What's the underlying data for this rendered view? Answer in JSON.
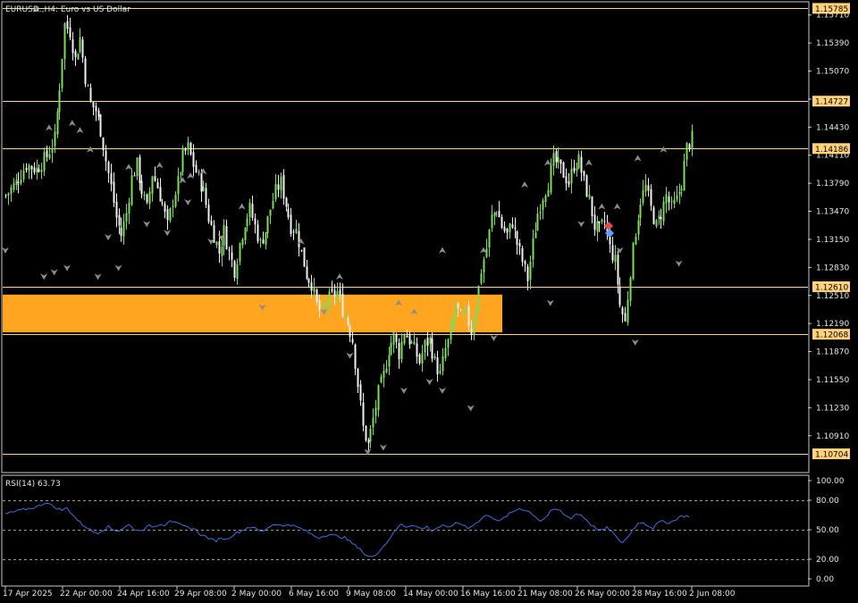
{
  "header": {
    "symbol_title": "EURUSD.,H4:  Euro vs US Dollar",
    "rsi_title": "RSI(14) 63.73"
  },
  "colors": {
    "background": "#000000",
    "bull_candle": "#7fdc5a",
    "bear_candle": "#f0f0f0",
    "level_line": "#ffd27a",
    "level_badge": "#ffd27a",
    "zone_fill": "#ffa51f",
    "rsi_line": "#3d6ee8",
    "frame": "#c8c8c8",
    "fractal": "#8c8c8c"
  },
  "price_axis": {
    "range": [
      1.105,
      1.1585
    ],
    "ticks": [
      "1.15710",
      "1.15390",
      "1.15070",
      "1.14750",
      "1.14430",
      "1.14110",
      "1.13790",
      "1.13470",
      "1.13150",
      "1.12830",
      "1.12510",
      "1.12190",
      "1.11870",
      "1.11550",
      "1.11230",
      "1.10910"
    ]
  },
  "level_badges": [
    {
      "label": "1.15785",
      "value": 1.15785
    },
    {
      "label": "1.14727",
      "value": 1.14727
    },
    {
      "label": "1.14186",
      "value": 1.14186
    },
    {
      "label": "1.12610",
      "value": 1.1261
    },
    {
      "label": "1.12068",
      "value": 1.12068
    },
    {
      "label": "1.10704",
      "value": 1.10704
    }
  ],
  "zone": {
    "top": 1.1252,
    "bottom": 1.1209
  },
  "rsi_axis": {
    "range": [
      0,
      100
    ],
    "ticks": [
      "100.00",
      "80.00",
      "50.00",
      "20.00",
      "0.00"
    ],
    "dashed_levels": [
      80,
      50,
      20
    ]
  },
  "time_axis": {
    "labels": [
      "17 Apr 2025",
      "22 Apr 00:00",
      "24 Apr 16:00",
      "29 Apr 08:00",
      "2 May 00:00",
      "6 May 16:00",
      "9 May 08:00",
      "14 May 00:00",
      "16 May 16:00",
      "21 May 08:00",
      "26 May 00:00",
      "28 May 16:00",
      "2 Jun 08:00"
    ]
  },
  "chart_data": {
    "type": "candlestick",
    "title": "EURUSD.,H4:  Euro vs US Dollar",
    "timeframe": "H4",
    "x_label_count": 13,
    "close_path": [
      [
        0,
        1.1365
      ],
      [
        4,
        1.138
      ],
      [
        8,
        1.14
      ],
      [
        12,
        1.1395
      ],
      [
        16,
        1.141
      ],
      [
        19,
        1.143
      ],
      [
        21,
        1.149
      ],
      [
        23,
        1.156
      ],
      [
        25,
        1.1552
      ],
      [
        27,
        1.152
      ],
      [
        29,
        1.1545
      ],
      [
        31,
        1.15
      ],
      [
        33,
        1.147
      ],
      [
        35,
        1.1462
      ],
      [
        37,
        1.144
      ],
      [
        39,
        1.1405
      ],
      [
        41,
        1.1375
      ],
      [
        43,
        1.134
      ],
      [
        45,
        1.132
      ],
      [
        47,
        1.1345
      ],
      [
        49,
        1.1385
      ],
      [
        51,
        1.14
      ],
      [
        53,
        1.137
      ],
      [
        55,
        1.135
      ],
      [
        57,
        1.139
      ],
      [
        59,
        1.1375
      ],
      [
        61,
        1.1355
      ],
      [
        63,
        1.133
      ],
      [
        65,
        1.136
      ],
      [
        67,
        1.138
      ],
      [
        69,
        1.141
      ],
      [
        71,
        1.142
      ],
      [
        73,
        1.14
      ],
      [
        75,
        1.1385
      ],
      [
        77,
        1.137
      ],
      [
        79,
        1.134
      ],
      [
        81,
        1.132
      ],
      [
        83,
        1.13
      ],
      [
        85,
        1.1325
      ],
      [
        87,
        1.13
      ],
      [
        89,
        1.128
      ],
      [
        91,
        1.131
      ],
      [
        93,
        1.1335
      ],
      [
        95,
        1.135
      ],
      [
        97,
        1.133
      ],
      [
        99,
        1.131
      ],
      [
        101,
        1.1325
      ],
      [
        103,
        1.135
      ],
      [
        105,
        1.137
      ],
      [
        107,
        1.138
      ],
      [
        109,
        1.1355
      ],
      [
        111,
        1.133
      ],
      [
        113,
        1.1325
      ],
      [
        115,
        1.13
      ],
      [
        117,
        1.1275
      ],
      [
        119,
        1.1265
      ],
      [
        121,
        1.124
      ],
      [
        123,
        1.123
      ],
      [
        125,
        1.1245
      ],
      [
        127,
        1.125
      ],
      [
        129,
        1.1255
      ],
      [
        131,
        1.1235
      ],
      [
        133,
        1.122
      ],
      [
        135,
        1.12
      ],
      [
        137,
        1.115
      ],
      [
        139,
        1.11
      ],
      [
        141,
        1.108
      ],
      [
        143,
        1.111
      ],
      [
        145,
        1.114
      ],
      [
        147,
        1.116
      ],
      [
        149,
        1.119
      ],
      [
        151,
        1.1205
      ],
      [
        153,
        1.1185
      ],
      [
        155,
        1.121
      ],
      [
        157,
        1.12
      ],
      [
        159,
        1.119
      ],
      [
        161,
        1.1175
      ],
      [
        163,
        1.1195
      ],
      [
        165,
        1.12
      ],
      [
        167,
        1.1175
      ],
      [
        169,
        1.116
      ],
      [
        171,
        1.119
      ],
      [
        173,
        1.1205
      ],
      [
        175,
        1.124
      ],
      [
        177,
        1.1225
      ],
      [
        179,
        1.123
      ],
      [
        181,
        1.121
      ],
      [
        183,
        1.124
      ],
      [
        185,
        1.128
      ],
      [
        187,
        1.1305
      ],
      [
        189,
        1.134
      ],
      [
        191,
        1.135
      ],
      [
        193,
        1.133
      ],
      [
        195,
        1.132
      ],
      [
        197,
        1.1335
      ],
      [
        199,
        1.131
      ],
      [
        201,
        1.129
      ],
      [
        203,
        1.127
      ],
      [
        205,
        1.131
      ],
      [
        207,
        1.1345
      ],
      [
        209,
        1.1365
      ],
      [
        211,
        1.138
      ],
      [
        213,
        1.1405
      ],
      [
        215,
        1.14
      ],
      [
        217,
        1.139
      ],
      [
        219,
        1.138
      ],
      [
        221,
        1.14
      ],
      [
        223,
        1.1405
      ],
      [
        225,
        1.138
      ],
      [
        227,
        1.136
      ],
      [
        229,
        1.133
      ],
      [
        231,
        1.1325
      ],
      [
        233,
        1.1335
      ],
      [
        235,
        1.1305
      ],
      [
        237,
        1.129
      ],
      [
        239,
        1.124
      ],
      [
        241,
        1.122
      ],
      [
        243,
        1.128
      ],
      [
        245,
        1.1325
      ],
      [
        247,
        1.136
      ],
      [
        249,
        1.1375
      ],
      [
        251,
        1.135
      ],
      [
        253,
        1.133
      ],
      [
        255,
        1.1345
      ],
      [
        257,
        1.1365
      ],
      [
        259,
        1.135
      ],
      [
        261,
        1.136
      ],
      [
        263,
        1.138
      ],
      [
        265,
        1.142
      ],
      [
        267,
        1.143
      ]
    ],
    "rsi_path": [
      [
        0,
        66
      ],
      [
        6,
        70
      ],
      [
        12,
        73
      ],
      [
        16,
        78
      ],
      [
        19,
        73
      ],
      [
        22,
        70
      ],
      [
        24,
        72
      ],
      [
        26,
        66
      ],
      [
        28,
        60
      ],
      [
        30,
        55
      ],
      [
        32,
        52
      ],
      [
        34,
        48
      ],
      [
        36,
        47
      ],
      [
        38,
        50
      ],
      [
        40,
        53
      ],
      [
        42,
        50
      ],
      [
        44,
        49
      ],
      [
        46,
        52
      ],
      [
        48,
        55
      ],
      [
        50,
        51
      ],
      [
        52,
        49
      ],
      [
        54,
        51
      ],
      [
        56,
        54
      ],
      [
        58,
        53
      ],
      [
        60,
        56
      ],
      [
        62,
        55
      ],
      [
        64,
        60
      ],
      [
        66,
        57
      ],
      [
        68,
        55
      ],
      [
        70,
        53
      ],
      [
        72,
        52
      ],
      [
        74,
        50
      ],
      [
        76,
        45
      ],
      [
        78,
        43
      ],
      [
        80,
        40
      ],
      [
        82,
        39
      ],
      [
        84,
        42
      ],
      [
        86,
        40
      ],
      [
        88,
        44
      ],
      [
        90,
        47
      ],
      [
        92,
        49
      ],
      [
        94,
        52
      ],
      [
        96,
        53
      ],
      [
        98,
        50
      ],
      [
        100,
        48
      ],
      [
        102,
        52
      ],
      [
        104,
        55
      ],
      [
        106,
        56
      ],
      [
        108,
        53
      ],
      [
        110,
        56
      ],
      [
        112,
        54
      ],
      [
        114,
        52
      ],
      [
        116,
        50
      ],
      [
        118,
        47
      ],
      [
        120,
        44
      ],
      [
        122,
        42
      ],
      [
        124,
        44
      ],
      [
        126,
        45
      ],
      [
        128,
        44
      ],
      [
        130,
        43
      ],
      [
        132,
        42
      ],
      [
        134,
        38
      ],
      [
        136,
        34
      ],
      [
        138,
        31
      ],
      [
        140,
        24
      ],
      [
        142,
        22
      ],
      [
        144,
        25
      ],
      [
        146,
        30
      ],
      [
        148,
        36
      ],
      [
        150,
        43
      ],
      [
        152,
        50
      ],
      [
        154,
        56
      ],
      [
        156,
        53
      ],
      [
        158,
        55
      ],
      [
        160,
        53
      ],
      [
        162,
        51
      ],
      [
        164,
        53
      ],
      [
        166,
        49
      ],
      [
        168,
        52
      ],
      [
        170,
        54
      ],
      [
        172,
        52
      ],
      [
        174,
        55
      ],
      [
        176,
        57
      ],
      [
        178,
        55
      ],
      [
        180,
        52
      ],
      [
        182,
        55
      ],
      [
        184,
        58
      ],
      [
        186,
        63
      ],
      [
        188,
        65
      ],
      [
        190,
        62
      ],
      [
        192,
        58
      ],
      [
        194,
        62
      ],
      [
        196,
        66
      ],
      [
        198,
        69
      ],
      [
        200,
        72
      ],
      [
        202,
        70
      ],
      [
        204,
        68
      ],
      [
        206,
        64
      ],
      [
        208,
        59
      ],
      [
        210,
        62
      ],
      [
        212,
        68
      ],
      [
        214,
        71
      ],
      [
        216,
        69
      ],
      [
        218,
        64
      ],
      [
        220,
        62
      ],
      [
        222,
        66
      ],
      [
        224,
        65
      ],
      [
        226,
        60
      ],
      [
        228,
        55
      ],
      [
        230,
        51
      ],
      [
        232,
        49
      ],
      [
        234,
        52
      ],
      [
        236,
        48
      ],
      [
        238,
        41
      ],
      [
        240,
        37
      ],
      [
        242,
        42
      ],
      [
        244,
        50
      ],
      [
        246,
        56
      ],
      [
        248,
        58
      ],
      [
        250,
        54
      ],
      [
        252,
        52
      ],
      [
        254,
        57
      ],
      [
        256,
        59
      ],
      [
        258,
        57
      ],
      [
        260,
        59
      ],
      [
        262,
        63
      ],
      [
        264,
        64
      ],
      [
        266,
        63.73
      ]
    ],
    "fractals_up": [
      [
        12,
        1.157
      ],
      [
        17,
        1.1435
      ],
      [
        26,
        1.144
      ],
      [
        29,
        1.1432
      ],
      [
        33,
        1.141
      ],
      [
        48,
        1.139
      ],
      [
        60,
        1.1392
      ],
      [
        69,
        1.1375
      ],
      [
        72,
        1.138
      ],
      [
        77,
        1.1385
      ],
      [
        92,
        1.1345
      ],
      [
        115,
        1.1305
      ],
      [
        130,
        1.1265
      ],
      [
        153,
        1.1235
      ],
      [
        159,
        1.1225
      ],
      [
        170,
        1.1295
      ],
      [
        186,
        1.1295
      ],
      [
        202,
        1.137
      ],
      [
        211,
        1.1395
      ],
      [
        227,
        1.1395
      ],
      [
        232,
        1.1345
      ],
      [
        238,
        1.1345
      ],
      [
        246,
        1.14
      ],
      [
        256,
        1.141
      ]
    ],
    "fractals_down": [
      [
        0,
        1.131
      ],
      [
        15,
        1.128
      ],
      [
        19,
        1.1285
      ],
      [
        24,
        1.129
      ],
      [
        36,
        1.128
      ],
      [
        40,
        1.1325
      ],
      [
        44,
        1.129
      ],
      [
        55,
        1.134
      ],
      [
        63,
        1.133
      ],
      [
        71,
        1.1365
      ],
      [
        80,
        1.132
      ],
      [
        84,
        1.1325
      ],
      [
        100,
        1.1245
      ],
      [
        124,
        1.124
      ],
      [
        134,
        1.119
      ],
      [
        141,
        1.108
      ],
      [
        147,
        1.1085
      ],
      [
        155,
        1.115
      ],
      [
        165,
        1.116
      ],
      [
        170,
        1.115
      ],
      [
        181,
        1.113
      ],
      [
        190,
        1.121
      ],
      [
        212,
        1.125
      ],
      [
        224,
        1.134
      ],
      [
        239,
        1.131
      ],
      [
        245,
        1.1205
      ],
      [
        262,
        1.1295
      ]
    ]
  }
}
